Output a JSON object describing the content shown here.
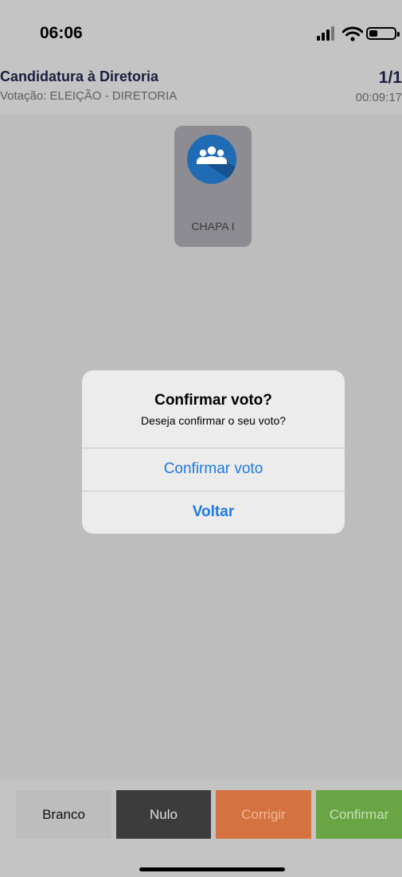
{
  "status_bar": {
    "time": "06:06",
    "icons": [
      "signal-icon",
      "wifi-icon",
      "battery-icon"
    ]
  },
  "header": {
    "title": "Candidatura à Diretoria",
    "subtitle": "Votação: ELEIÇÃO - DIRETORIA",
    "counter": "1/1",
    "timer": "00:09:17"
  },
  "candidate": {
    "label": "CHAPA I",
    "icon": "group-icon"
  },
  "dialog": {
    "title": "Confirmar voto?",
    "message": "Deseja confirmar o seu voto?",
    "confirm_label": "Confirmar voto",
    "back_label": "Voltar"
  },
  "actions": {
    "branco": "Branco",
    "nulo": "Nulo",
    "corrigir": "Corrigir",
    "confirmar": "Confirmar"
  },
  "colors": {
    "background": "#c4c4c4",
    "title": "#1b1d3e",
    "accent_blue": "#1e7ae0",
    "avatar_blue": "#1f6cb5",
    "branco_btn": "#bdbdbd",
    "nulo_btn": "#3c3c3c",
    "corrigir_btn": "#d4733f",
    "confirmar_btn": "#69a544"
  }
}
